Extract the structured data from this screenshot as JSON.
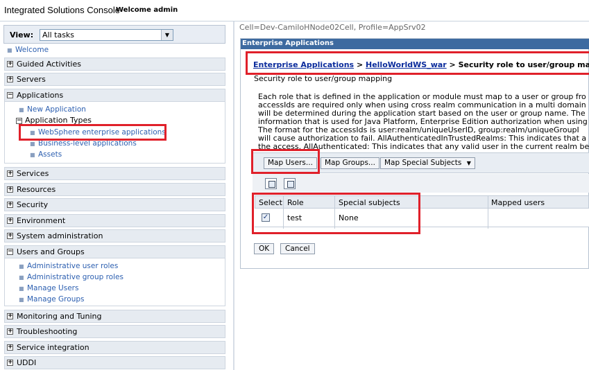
{
  "header": {
    "title": "Integrated Solutions Console",
    "welcome": "Welcome admin"
  },
  "nav": {
    "view_label": "View:",
    "view_value": "All tasks",
    "welcome_link": "Welcome",
    "sections": [
      "Guided Activities",
      "Servers",
      "Applications",
      "Services",
      "Resources",
      "Security",
      "Environment",
      "System administration",
      "Users and Groups",
      "Monitoring and Tuning",
      "Troubleshooting",
      "Service integration",
      "UDDI"
    ],
    "applications": {
      "new_application": "New Application",
      "application_types": "Application Types",
      "websphere_apps": "WebSphere enterprise applications",
      "business_level": "Business-level applications",
      "assets": "Assets"
    },
    "users_groups": {
      "admin_user_roles": "Administrative user roles",
      "admin_group_roles": "Administrative group roles",
      "manage_users": "Manage Users",
      "manage_groups": "Manage Groups"
    }
  },
  "content": {
    "cell_info": "Cell=Dev-CamiloHNode02Cell, Profile=AppSrv02",
    "panel_title": "Enterprise Applications",
    "breadcrumb": {
      "link1": "Enterprise Applications",
      "sep": " > ",
      "link2": "HelloWorldWS_war",
      "current": "Security role to user/group mapping"
    },
    "page_title": "Security role to user/group mapping",
    "description_lines": [
      "Each role that is defined in the application or module must map to a user or group fro",
      "accessIds are required only when using cross realm communication in a multi domain",
      "will be determined during the application start based on the user or group name. The",
      "information that is used for Java Platform, Enterprise Edition authorization when using",
      "The format for the accessIds is user:realm/uniqueUserID, group:realm/uniqueGroupI",
      "will cause authorization to fail. AllAuthenticatedInTrustedRealms: This indicates that a",
      "the access. AllAuthenticated: This indicates that any valid user in the current realm be"
    ],
    "buttons": {
      "map_users": "Map Users...",
      "map_groups": "Map Groups...",
      "map_special": "Map Special Subjects",
      "ok": "OK",
      "cancel": "Cancel"
    },
    "table": {
      "headers": [
        "Select",
        "Role",
        "Special subjects",
        "Mapped users"
      ],
      "rows": [
        {
          "selected": true,
          "role": "test",
          "special": "None",
          "mapped": ""
        }
      ]
    }
  },
  "colors": {
    "panel_header": "#3d6aa0",
    "link": "#2c5fb0",
    "annotation_red": "#e0202a"
  }
}
